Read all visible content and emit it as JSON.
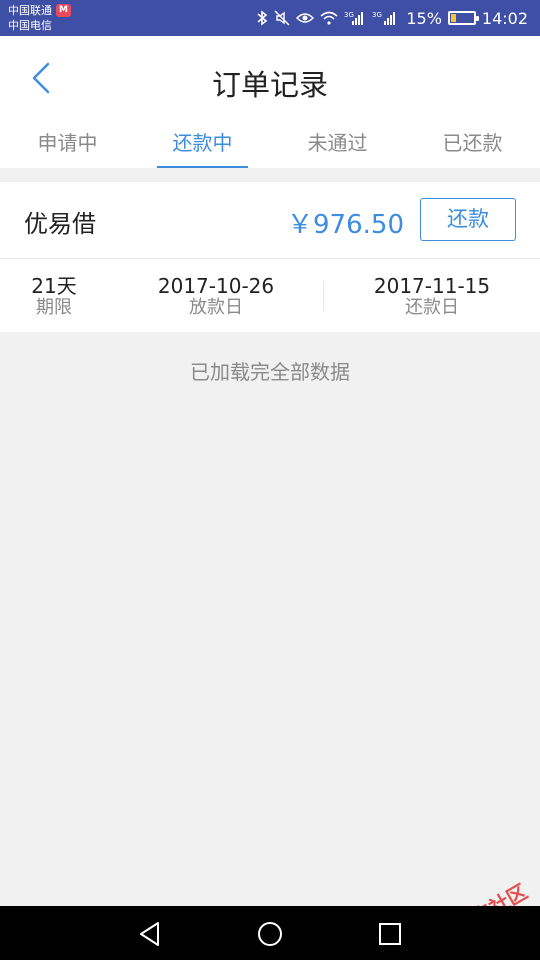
{
  "status_bar": {
    "carrier1": "中国联通",
    "carrier2": "中国电信",
    "battery": "15%",
    "time": "14:02",
    "signal1_tag": "3G",
    "signal2_tag": "3G"
  },
  "header": {
    "title": "订单记录"
  },
  "tabs": [
    {
      "label": "申请中",
      "active": false
    },
    {
      "label": "还款中",
      "active": true
    },
    {
      "label": "未通过",
      "active": false
    },
    {
      "label": "已还款",
      "active": false
    }
  ],
  "order": {
    "lender": "优易借",
    "amount": "￥976.50",
    "repay_label": "还款",
    "term_value": "21天",
    "term_label": "期限",
    "loan_date": "2017-10-26",
    "loan_date_label": "放款日",
    "due_date": "2017-11-15",
    "due_date_label": "还款日"
  },
  "list_footer": "已加载完全部数据",
  "watermark": "卡农社区",
  "colors": {
    "status_bar": "#3f4fa6",
    "accent": "#3c8de0",
    "background": "#f1f1f1"
  }
}
